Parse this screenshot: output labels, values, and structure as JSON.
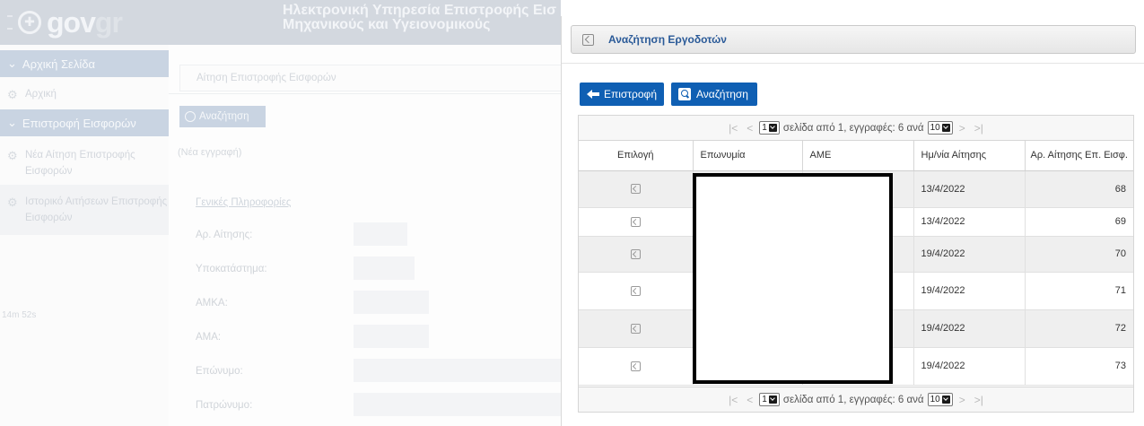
{
  "background": {
    "brand": {
      "main": "gov",
      "accent": "gr"
    },
    "header_title": [
      "Ηλεκτρονική Υπηρεσία Επιστροφής Εισ",
      "Μηχανικούς και Υγειονομικούς"
    ],
    "sidebar": {
      "sections": [
        {
          "label": "Αρχική Σελίδα"
        },
        {
          "label": "Επιστροφή Εισφορών"
        }
      ],
      "items": [
        {
          "label": "Αρχική"
        },
        {
          "label": "Νέα Αίτηση Επιστροφής Εισφορών"
        },
        {
          "label": "Ιστορικό Αιτήσεων Επιστροφής Εισφορών"
        }
      ],
      "timer": "14m 52s"
    },
    "breadcrumb": "Αίτηση Επιστροφής Εισφορών",
    "search_button": "Αναζήτηση",
    "new_record": "(Νέα εγγραφή)",
    "section_title": "Γενικές Πληροφορίες",
    "fields": [
      {
        "label": "Αρ. Αίτησης:"
      },
      {
        "label": "Υποκατάστημα:"
      },
      {
        "label": "ΑΜΚΑ:"
      },
      {
        "label": "ΑΜΑ:"
      },
      {
        "label": "Επώνυμο:"
      },
      {
        "label": "Πατρώνυμο:"
      }
    ]
  },
  "dialog": {
    "title": "Αναζήτηση Εργοδοτών",
    "back_button": "Επιστροφή",
    "search_button": "Αναζήτηση",
    "pager": {
      "first": "|<",
      "prev": "<",
      "page": "1",
      "text": "σελίδα από 1, εγγραφές: 6 ανά",
      "page_size": "10",
      "next": ">",
      "last": ">|"
    },
    "columns": [
      "Επιλογή",
      "Επωνυμία",
      "ΑΜΕ",
      "Ημ/νία Αίτησης",
      "Αρ. Αίτησης Επ. Εισφ."
    ],
    "rows": [
      {
        "name": "",
        "ame": "",
        "date": "13/4/2022",
        "number": "68"
      },
      {
        "name": "",
        "ame": "",
        "date": "13/4/2022",
        "number": "69"
      },
      {
        "name": "",
        "ame": "",
        "date": "19/4/2022",
        "number": "70"
      },
      {
        "name": "",
        "ame": "",
        "date": "19/4/2022",
        "number": "71"
      },
      {
        "name": "",
        "ame": "",
        "date": "19/4/2022",
        "number": "72"
      },
      {
        "name": "",
        "ame": "",
        "date": "19/4/2022",
        "number": "73"
      }
    ],
    "colors": {
      "accent": "#0f5fb3",
      "title": "#2a5a98"
    }
  }
}
